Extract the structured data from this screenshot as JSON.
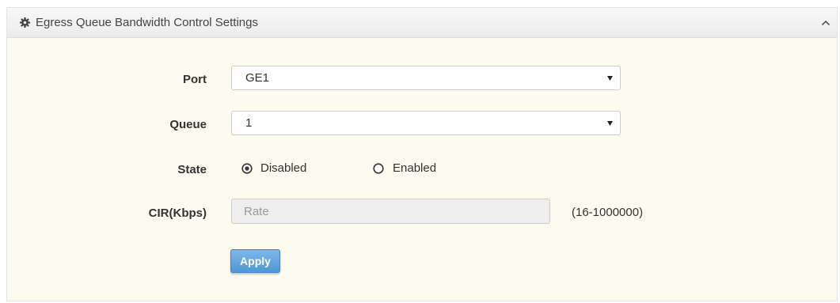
{
  "panel": {
    "title": "Egress Queue Bandwidth Control Settings",
    "icon": "gear-icon",
    "collapse_icon": "chevron-up-icon"
  },
  "form": {
    "port": {
      "label": "Port",
      "value": "GE1"
    },
    "queue": {
      "label": "Queue",
      "value": "1"
    },
    "state": {
      "label": "State",
      "options": [
        {
          "label": "Disabled",
          "selected": true
        },
        {
          "label": "Enabled",
          "selected": false
        }
      ]
    },
    "cir": {
      "label": "CIR(Kbps)",
      "placeholder": "Rate",
      "hint": "(16-1000000)"
    },
    "apply_label": "Apply"
  },
  "colors": {
    "accent": "#5aa0db",
    "panel_bg": "#fdfaf0"
  }
}
